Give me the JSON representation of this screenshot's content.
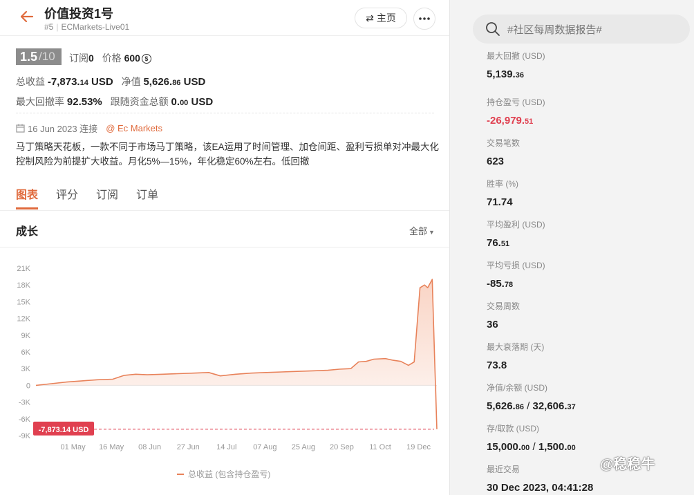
{
  "header": {
    "title": "价值投资1号",
    "rank": "#5",
    "account": "ECMarkets-Live01",
    "home_label": "主页"
  },
  "summary": {
    "rating": "1.5",
    "rating_den": "/10",
    "subscribe_label": "订阅",
    "subscribe_count": "0",
    "price_label": "价格",
    "price_value": "600",
    "total_profit_label": "总收益",
    "total_profit_main": "-7,873.",
    "total_profit_dec": "14",
    "total_profit_unit": " USD",
    "net_label": "净值",
    "net_main": "5,626.",
    "net_dec": "86",
    "net_unit": " USD",
    "max_dd_rate_label": "最大回撤率",
    "max_dd_rate_value": "92.53%",
    "follow_funds_label": "跟随资金总额",
    "follow_funds_main": "0.",
    "follow_funds_dec": "00",
    "follow_funds_unit": " USD",
    "connect_date": "16 Jun 2023 连接",
    "broker": "@ Ec Markets",
    "description": "马丁策略天花板，一款不同于市场马丁策略，该EA运用了时间管理、加仓间距、盈利亏损单对冲最大化控制风险为前提扩大收益。月化5%—15%，年化稳定60%左右。低回撤"
  },
  "tabs": [
    {
      "label": "图表",
      "active": true
    },
    {
      "label": "评分",
      "active": false
    },
    {
      "label": "订阅",
      "active": false
    },
    {
      "label": "订单",
      "active": false
    }
  ],
  "growth": {
    "title": "成长",
    "range_label": "全部"
  },
  "chart_data": {
    "type": "area",
    "x_ticks": [
      "01 May",
      "16 May",
      "08 Jun",
      "27 Jun",
      "14 Jul",
      "07 Aug",
      "25 Aug",
      "20 Sep",
      "11 Oct",
      "19 Dec"
    ],
    "y_ticks": [
      "21K",
      "18K",
      "15K",
      "12K",
      "9K",
      "6K",
      "3K",
      "0",
      "-3K",
      "-6K",
      "-9K"
    ],
    "ylim": [
      -9000,
      21000
    ],
    "x": [
      0,
      0.4,
      0.8,
      1.2,
      1.6,
      2.0,
      2.3,
      2.6,
      2.9,
      3.3,
      3.7,
      4.1,
      4.5,
      4.8,
      5.2,
      5.6,
      6.0,
      6.4,
      6.8,
      7.2,
      7.6,
      7.9,
      8.2,
      8.4,
      8.6,
      8.8,
      9.1,
      9.3,
      9.5,
      9.7,
      9.85,
      10.0,
      10.12,
      10.2,
      10.32,
      10.38,
      10.44
    ],
    "y": [
      0,
      300,
      600,
      800,
      1000,
      1100,
      1800,
      2000,
      1900,
      2000,
      2100,
      2200,
      2300,
      1700,
      2000,
      2200,
      2300,
      2400,
      2500,
      2600,
      2700,
      2900,
      3000,
      4200,
      4300,
      4700,
      4800,
      4500,
      4300,
      3600,
      4200,
      17500,
      18000,
      17500,
      19000,
      5000,
      -7873.14
    ],
    "series_name": "总收益 (包含持仓盈亏)",
    "last_value_label": "-7,873.14 USD",
    "last_value": -7873.14,
    "line_color": "#e8825a",
    "marker_color": "#e04050"
  },
  "search": {
    "placeholder": "#社区每周数据报告#"
  },
  "stats": [
    {
      "label": "最大回撤 (USD)",
      "main": "5,139.",
      "dec": "36",
      "neg": false
    },
    {
      "label": "持仓盈亏 (USD)",
      "main": "-26,979.",
      "dec": "51",
      "neg": true
    },
    {
      "label": "交易笔数",
      "main": "623",
      "dec": "",
      "neg": false
    },
    {
      "label": "胜率 (%)",
      "main": "71.74",
      "dec": "",
      "neg": false
    },
    {
      "label": "平均盈利 (USD)",
      "main": "76.",
      "dec": "51",
      "neg": false
    },
    {
      "label": "平均亏损 (USD)",
      "main": "-85.",
      "dec": "78",
      "neg": false
    },
    {
      "label": "交易周数",
      "main": "36",
      "dec": "",
      "neg": false
    },
    {
      "label": "最大衰落期 (天)",
      "main": "73.8",
      "dec": "",
      "neg": false
    },
    {
      "label": "净值/余额 (USD)",
      "main": "5,626.",
      "dec": "86",
      "extra_main": "32,606.",
      "extra_dec": "37",
      "neg": false
    },
    {
      "label": "存/取款 (USD)",
      "main": "15,000.",
      "dec": "00",
      "extra_main": "1,500.",
      "extra_dec": "00",
      "neg": false
    },
    {
      "label": "最近交易",
      "main": "30 Dec 2023, 04:41:28",
      "dec": "",
      "neg": false
    }
  ],
  "watermark": "@稳稳牛",
  "colors": {
    "accent": "#e06a3c",
    "negative": "#e04050"
  }
}
